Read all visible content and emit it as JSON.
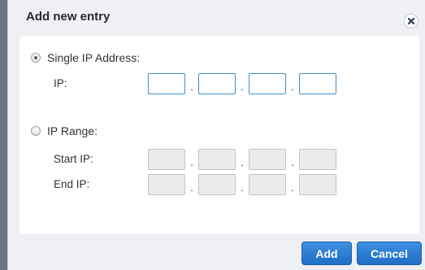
{
  "dialog": {
    "title": "Add new entry",
    "close_icon": "close-icon"
  },
  "single_ip": {
    "option_label": "Single IP Address:",
    "selected": true,
    "ip_label": "IP:",
    "octets": [
      "",
      "",
      "",
      ""
    ]
  },
  "ip_range": {
    "option_label": "IP Range:",
    "selected": false,
    "start_label": "Start IP:",
    "end_label": "End IP:",
    "start_octets": [
      "",
      "",
      "",
      ""
    ],
    "end_octets": [
      "",
      "",
      "",
      ""
    ]
  },
  "separator": ".",
  "buttons": {
    "add_label": "Add",
    "cancel_label": "Cancel"
  },
  "colors": {
    "accent": "#2a7bd4",
    "active_input_border": "#3f8fd2",
    "disabled_input_bg": "#ececec"
  }
}
